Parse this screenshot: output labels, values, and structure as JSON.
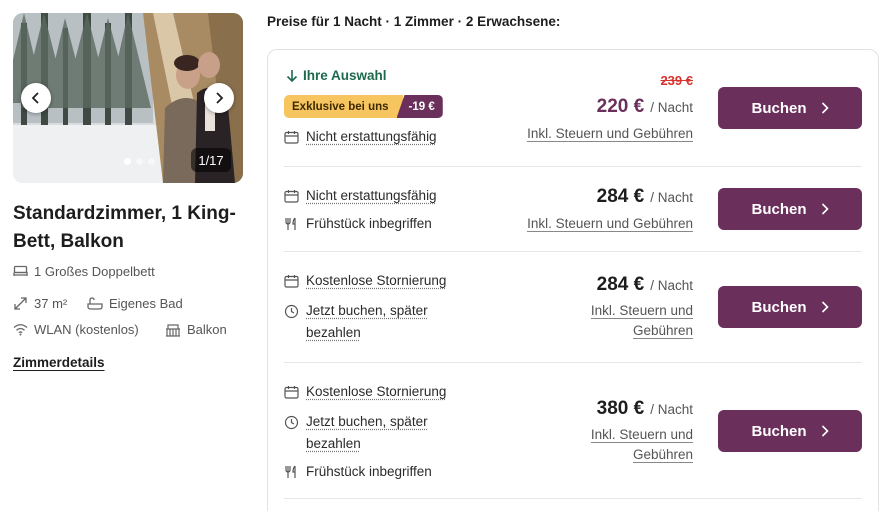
{
  "gallery": {
    "counter": "1/17",
    "dot_count": 3,
    "active_dot": 0
  },
  "room": {
    "title": "Standardzimmer, 1 King-Bett, Balkon",
    "features": {
      "bed": "1 Großes Doppelbett",
      "size": "37 m²",
      "bath": "Eigenes Bad",
      "wifi": "WLAN (kostenlos)",
      "balcony": "Balkon"
    },
    "details_link": "Zimmerdetails"
  },
  "prices_heading": "Preise für 1 Nacht · 1 Zimmer · 2 Erwachsene:",
  "offers": [
    {
      "selected_label": "Ihre Auswahl",
      "badge_label": "Exklusive bei uns",
      "badge_discount": "-19 €",
      "conditions": [
        "Nicht erstattungsfähig"
      ],
      "old_price": "239 €",
      "price": "220 €",
      "per_night": "/ Nacht",
      "tax_note": "Inkl. Steuern und Gebühren",
      "button": "Buchen"
    },
    {
      "conditions": [
        "Nicht erstattungsfähig",
        "Frühstück inbegriffen"
      ],
      "price": "284 €",
      "per_night": "/ Nacht",
      "tax_note": "Inkl. Steuern und Gebühren",
      "button": "Buchen"
    },
    {
      "conditions": [
        "Kostenlose Stornierung",
        "Jetzt buchen, später bezahlen"
      ],
      "price": "284 €",
      "per_night": "/ Nacht",
      "tax_note_line1": "Inkl. Steuern und",
      "tax_note_line2": "Gebühren",
      "button": "Buchen"
    },
    {
      "conditions": [
        "Kostenlose Stornierung",
        "Jetzt buchen, später bezahlen",
        "Frühstück inbegriffen"
      ],
      "price": "380 €",
      "per_night": "/ Nacht",
      "tax_note_line1": "Inkl. Steuern und",
      "tax_note_line2": "Gebühren",
      "button": "Buchen"
    }
  ],
  "colors": {
    "brand": "#6b2f5c",
    "selected_green": "#1d6a4e",
    "badge_yellow": "#f7c55f",
    "strike_red": "#d8322e"
  },
  "icons": {
    "calendar": "calendar-icon",
    "cutlery": "cutlery-icon",
    "clock": "clock-icon",
    "arrow_down": "arrow-down-icon",
    "chevron_right": "chevron-right-icon"
  }
}
